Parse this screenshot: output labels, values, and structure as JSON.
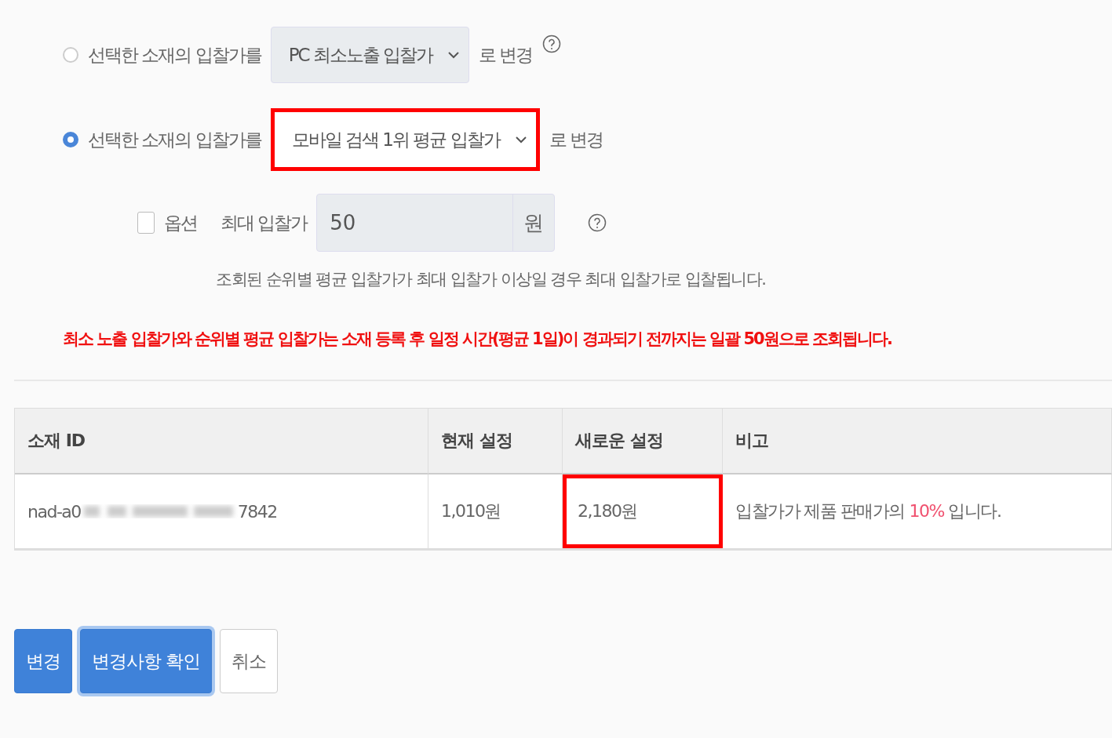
{
  "bid_options": [
    {
      "label": "선택한 소재의 입찰가를",
      "selected": false,
      "dropdown": {
        "value": "PC 최소노출 입찰가",
        "highlighted": false
      },
      "suffix": "로 변경",
      "help": true
    },
    {
      "label": "선택한 소재의 입찰가를",
      "selected": true,
      "dropdown": {
        "value": "모바일 검색 1위 평균 입찰가",
        "highlighted": true
      },
      "suffix": "로 변경",
      "help": false
    }
  ],
  "option": {
    "label": "옵션",
    "checked": false,
    "max_bid_label": "최대 입찰가",
    "max_bid_value": "50",
    "unit": "원",
    "hint": "조회된 순위별 평균 입찰가가 최대 입찰가 이상일 경우 최대 입찰가로 입찰됩니다."
  },
  "warning": "최소 노출 입찰가와 순위별 평균 입찰가는 소재 등록 후 일정 시간(평균 1일)이 경과되기 전까지는 일괄 50원으로 조회됩니다.",
  "table": {
    "columns": [
      "소재 ID",
      "현재 설정",
      "새로운 설정",
      "비고"
    ],
    "rows": [
      {
        "id_prefix": "nad-a0",
        "id_redacted": true,
        "id_suffix": "7842",
        "current": "1,010원",
        "new": {
          "value": "2,180원",
          "highlighted": true
        },
        "note": "입찰가가 제품 판매가의 **10%** 입니다."
      }
    ]
  },
  "buttons": [
    {
      "label": "변경",
      "kind": "primary",
      "focused": false
    },
    {
      "label": "변경사항 확인",
      "kind": "primary",
      "focused": true
    },
    {
      "label": "취소",
      "kind": "secondary",
      "focused": false
    }
  ]
}
